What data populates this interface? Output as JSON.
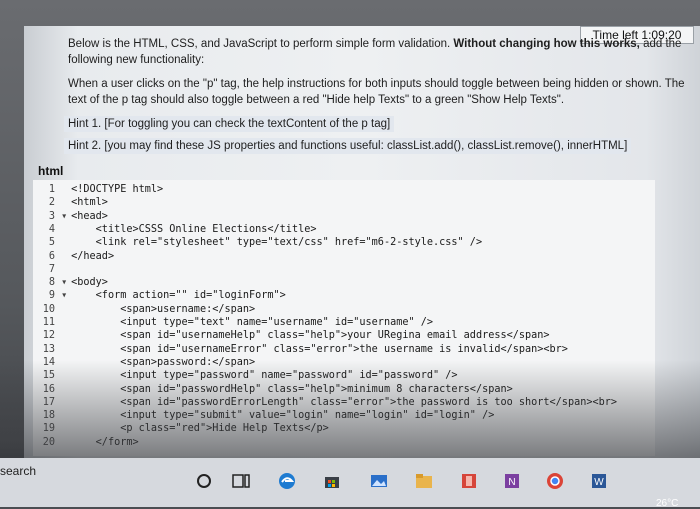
{
  "timer": {
    "text": "Time left 1:09:20"
  },
  "instructions": {
    "intro_start": "Below is the HTML, CSS, and JavaScript to perform simple form validation. ",
    "intro_bold": "Without changing how this works,",
    "intro_end": "add the following new functionality:",
    "task": "When a user clicks on the \"p\" tag, the help instructions for both inputs should toggle between being hidden or shown. The text of the p tag should also toggle between a red \"Hide help Texts\" to a green \"Show Help Texts\".",
    "hint1": "Hint 1. [For toggling you can check the textContent of the p tag]",
    "hint2": "Hint 2. [you may find these JS properties and functions useful: classList.add(), classList.remove(), innerHTML]"
  },
  "code_label": "html",
  "code_lines": [
    {
      "n": "1",
      "a": "",
      "t": "<!DOCTYPE html>"
    },
    {
      "n": "2",
      "a": "",
      "t": "<html>"
    },
    {
      "n": "3",
      "a": "▾",
      "t": "<head>"
    },
    {
      "n": "4",
      "a": "",
      "t": "    <title>CSSS Online Elections</title>"
    },
    {
      "n": "5",
      "a": "",
      "t": "    <link rel=\"stylesheet\" type=\"text/css\" href=\"m6-2-style.css\" />"
    },
    {
      "n": "6",
      "a": "",
      "t": "</head>"
    },
    {
      "n": "7",
      "a": "",
      "t": ""
    },
    {
      "n": "8",
      "a": "▾",
      "t": "<body>"
    },
    {
      "n": "9",
      "a": "▾",
      "t": "    <form action=\"\" id=\"loginForm\">"
    },
    {
      "n": "10",
      "a": "",
      "t": "        <span>username:</span>"
    },
    {
      "n": "11",
      "a": "",
      "t": "        <input type=\"text\" name=\"username\" id=\"username\" />"
    },
    {
      "n": "12",
      "a": "",
      "t": "        <span id=\"usernameHelp\" class=\"help\">your URegina email address</span>"
    },
    {
      "n": "13",
      "a": "",
      "t": "        <span id=\"usernameError\" class=\"error\">the username is invalid</span><br>"
    },
    {
      "n": "14",
      "a": "",
      "t": "        <span>password:</span>"
    },
    {
      "n": "15",
      "a": "",
      "t": "        <input type=\"password\" name=\"password\" id=\"password\" />"
    },
    {
      "n": "16",
      "a": "",
      "t": "        <span id=\"passwordHelp\" class=\"help\">minimum 8 characters</span>"
    },
    {
      "n": "17",
      "a": "",
      "t": "        <span id=\"passwordErrorLength\" class=\"error\">the password is too short</span><br>"
    },
    {
      "n": "18",
      "a": "",
      "t": "        <input type=\"submit\" value=\"login\" name=\"login\" id=\"login\" />"
    },
    {
      "n": "19",
      "a": "",
      "t": "        <p class=\"red\">Hide Help Texts</p>"
    },
    {
      "n": "20",
      "a": "",
      "t": "    </form>"
    }
  ],
  "taskbar": {
    "search_label": "search",
    "temperature": "26°C",
    "icons": [
      "cortana-icon",
      "task-view-icon",
      "edge-icon",
      "store-icon",
      "photos-icon",
      "files-icon",
      "teams-icon",
      "onenote-icon",
      "chrome-icon",
      "word-icon"
    ]
  }
}
